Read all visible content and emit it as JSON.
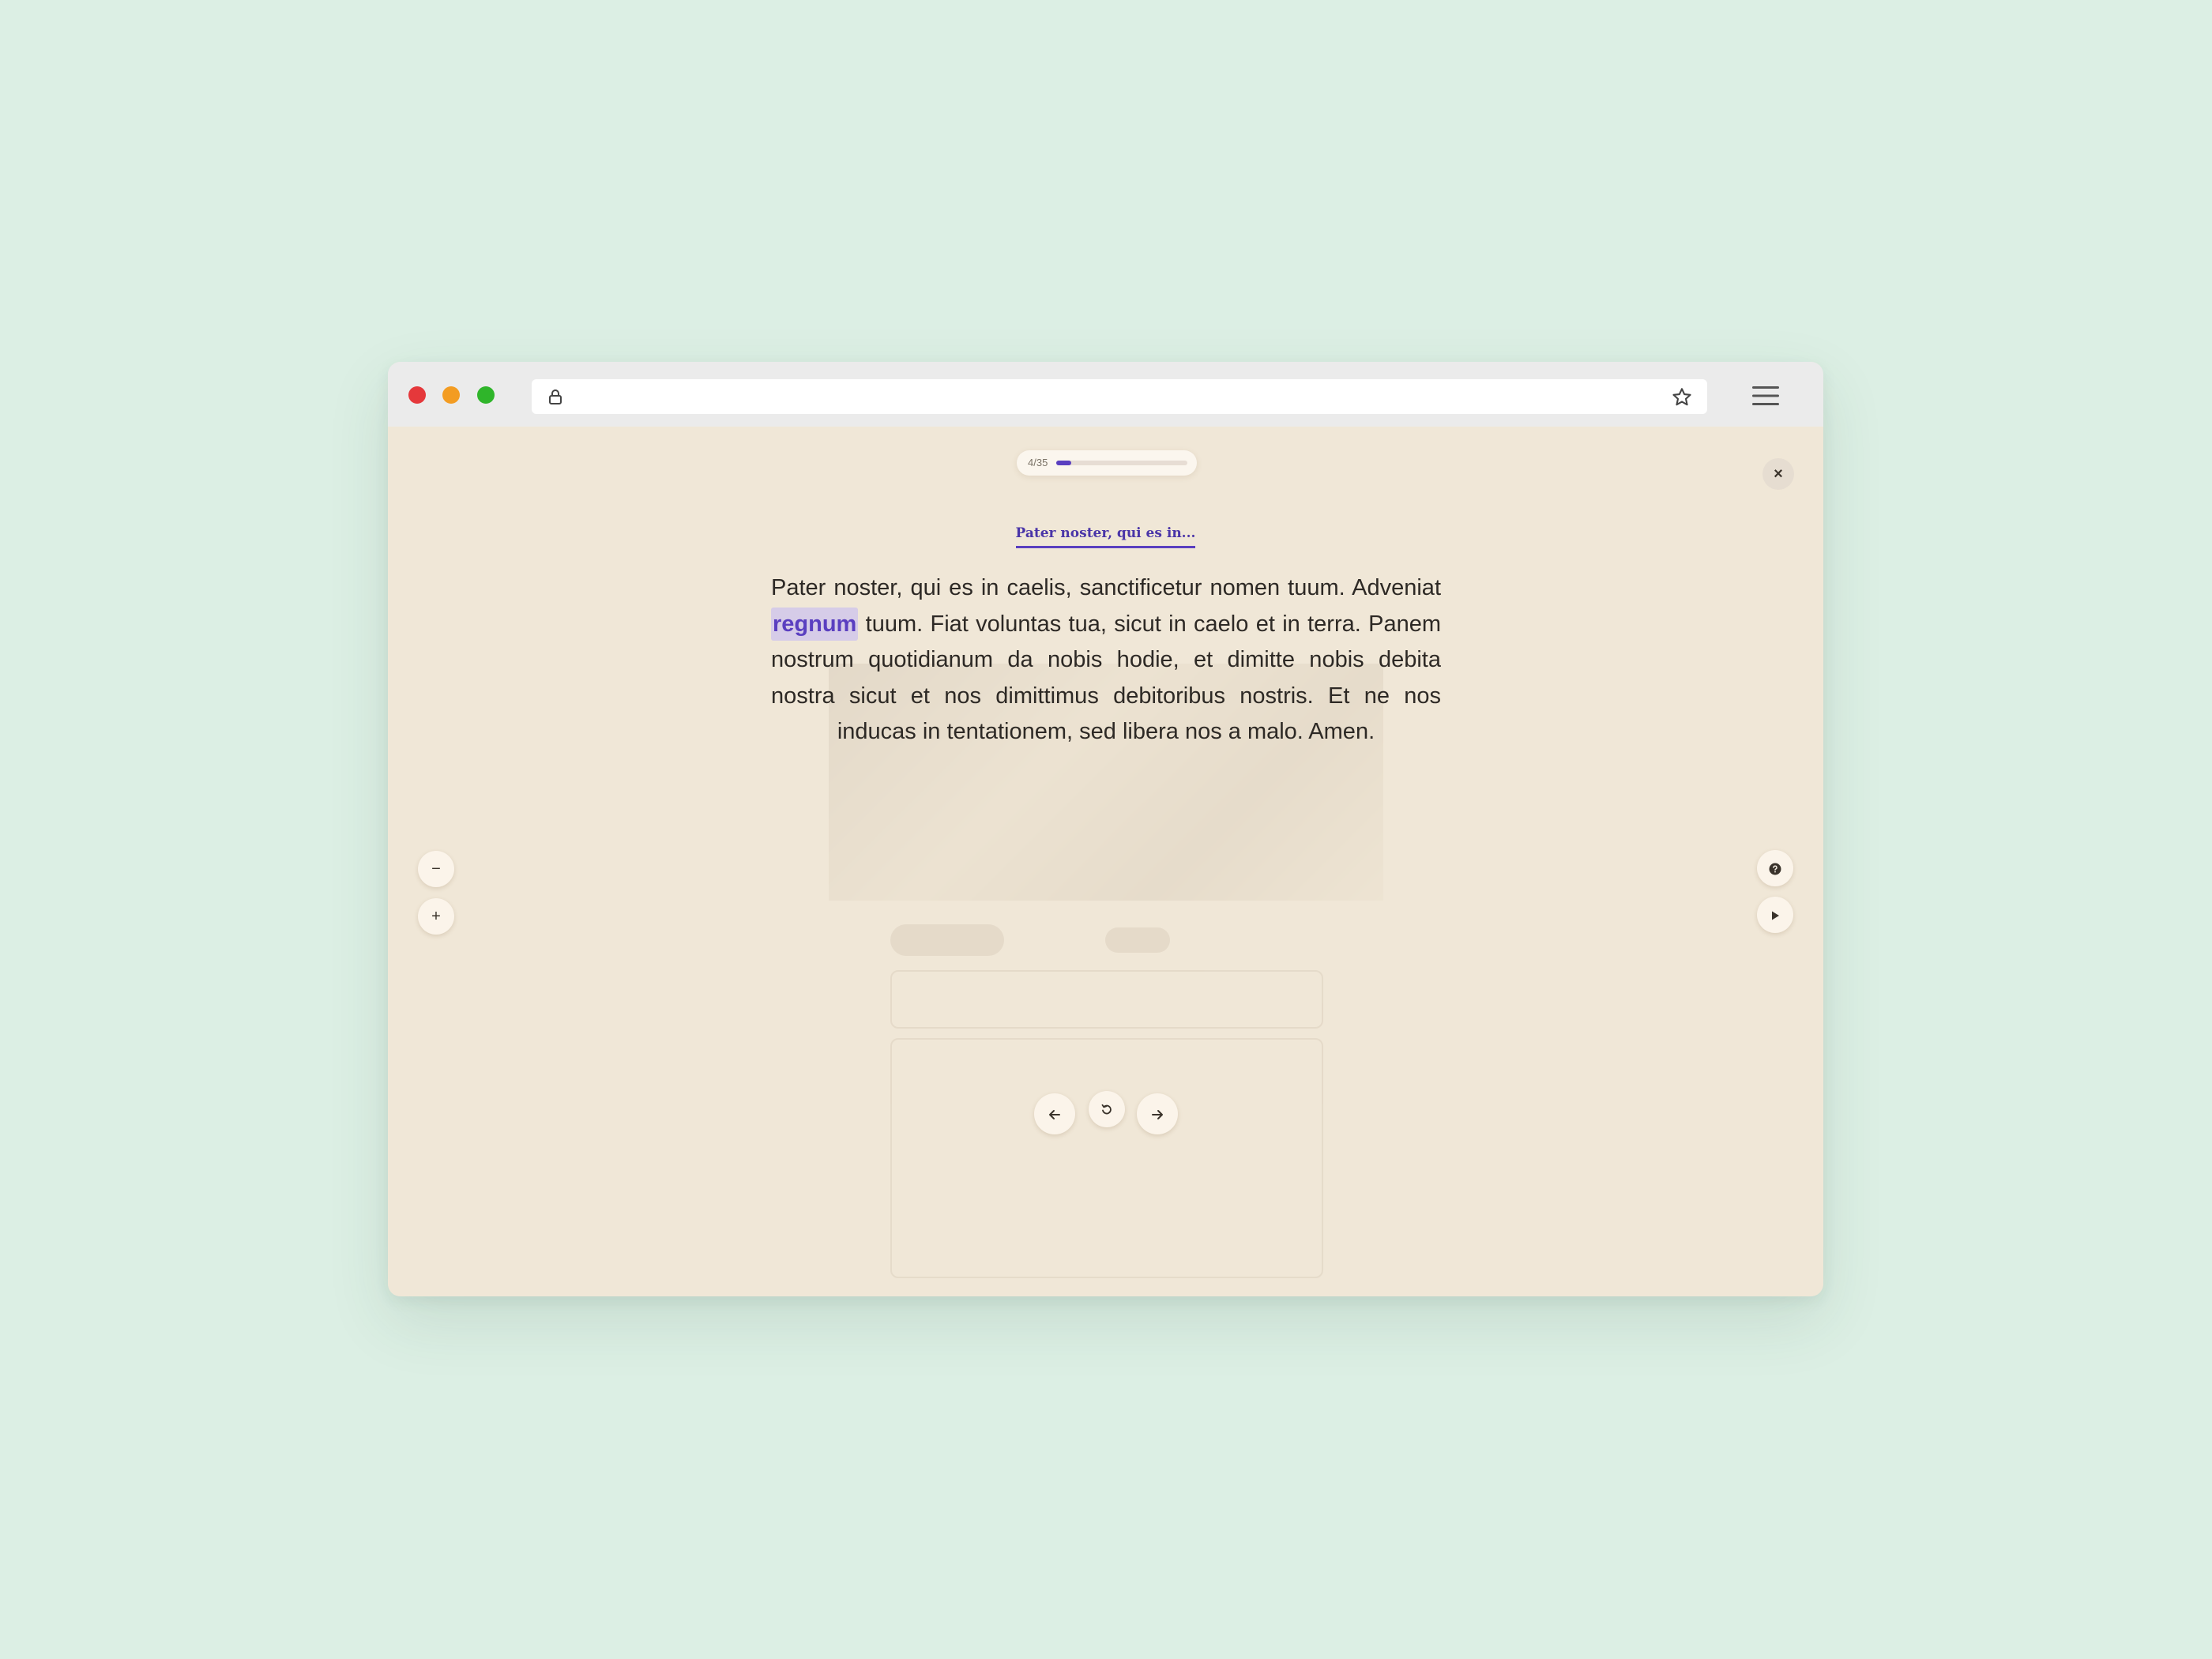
{
  "browser": {
    "url": "",
    "icons": {
      "lock": "lock-icon",
      "bookmark": "star-icon",
      "menu": "hamburger-menu-icon"
    }
  },
  "reader": {
    "progress": {
      "label": "4/35",
      "current": 4,
      "total": 35,
      "fraction": 0.114
    },
    "close_label": "×",
    "prayer_title": "Pater noster, qui es in...",
    "text_before": "Pater noster, qui es in caelis, sanctificetur nomen tuum. Adveniat ",
    "highlighted_word": "regnum",
    "text_after": " tuum. Fiat voluntas tua, sicut in caelo et in terra. Panem nostrum quotidianum da nobis hodie, et dimitte nobis debita nostra sicut et nos dimittimus debitoribus nostris. Et ne nos inducas in tentationem, sed libera nos a malo. Amen.",
    "font_decrease_label": "−",
    "font_increase_label": "+",
    "controls": {
      "help_icon": "help-icon",
      "play_icon": "play-icon",
      "prev_icon": "arrow-left-icon",
      "restart_icon": "restart-icon",
      "next_icon": "arrow-right-icon"
    }
  },
  "colors": {
    "accent": "#5a3fc0",
    "page_background": "#dcefe4",
    "reader_background": "#f0e7d7"
  }
}
